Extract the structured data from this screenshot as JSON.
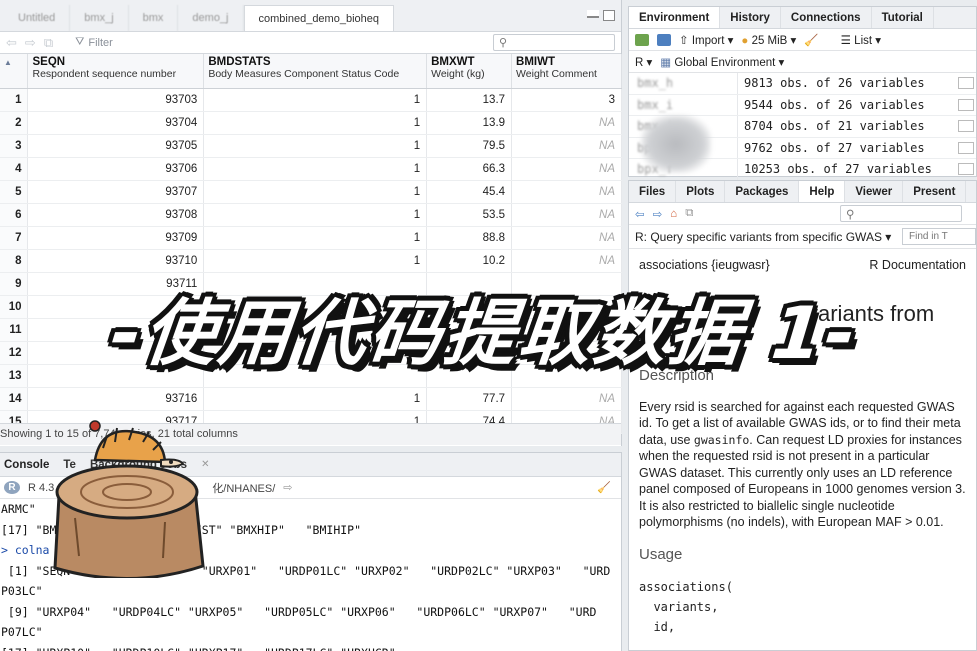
{
  "source_tabs": [
    "Untitled",
    "bmx_j",
    "bmx",
    "demo_j",
    "combined_demo_bioheq"
  ],
  "viewer": {
    "filter_label": "Filter",
    "columns": [
      {
        "name": "SEQN",
        "label": "Respondent sequence number"
      },
      {
        "name": "BMDSTATS",
        "label": "Body Measures Component Status Code"
      },
      {
        "name": "BMXWT",
        "label": "Weight (kg)"
      },
      {
        "name": "BMIWT",
        "label": "Weight Comment"
      }
    ],
    "rows": [
      {
        "n": "1",
        "seqn": "93703",
        "bmdstats": "1",
        "bmxwt": "13.7",
        "bmiwt": "3"
      },
      {
        "n": "2",
        "seqn": "93704",
        "bmdstats": "1",
        "bmxwt": "13.9",
        "bmiwt": "NA"
      },
      {
        "n": "3",
        "seqn": "93705",
        "bmdstats": "1",
        "bmxwt": "79.5",
        "bmiwt": "NA"
      },
      {
        "n": "4",
        "seqn": "93706",
        "bmdstats": "1",
        "bmxwt": "66.3",
        "bmiwt": "NA"
      },
      {
        "n": "5",
        "seqn": "93707",
        "bmdstats": "1",
        "bmxwt": "45.4",
        "bmiwt": "NA"
      },
      {
        "n": "6",
        "seqn": "93708",
        "bmdstats": "1",
        "bmxwt": "53.5",
        "bmiwt": "NA"
      },
      {
        "n": "7",
        "seqn": "93709",
        "bmdstats": "1",
        "bmxwt": "88.8",
        "bmiwt": "NA"
      },
      {
        "n": "8",
        "seqn": "93710",
        "bmdstats": "1",
        "bmxwt": "10.2",
        "bmiwt": "NA"
      },
      {
        "n": "9",
        "seqn": "93711",
        "bmdstats": "",
        "bmxwt": "",
        "bmiwt": ""
      },
      {
        "n": "10",
        "seqn": "",
        "bmdstats": "",
        "bmxwt": "",
        "bmiwt": ""
      },
      {
        "n": "11",
        "seqn": "",
        "bmdstats": "",
        "bmxwt": "",
        "bmiwt": ""
      },
      {
        "n": "12",
        "seqn": "",
        "bmdstats": "",
        "bmxwt": "",
        "bmiwt": ""
      },
      {
        "n": "13",
        "seqn": "",
        "bmdstats": "",
        "bmxwt": "",
        "bmiwt": ""
      },
      {
        "n": "14",
        "seqn": "93716",
        "bmdstats": "1",
        "bmxwt": "77.7",
        "bmiwt": "NA"
      },
      {
        "n": "15",
        "seqn": "93717",
        "bmdstats": "1",
        "bmxwt": "74.4",
        "bmiwt": "NA"
      }
    ],
    "status": "Showing 1 to 15 of 7,74 entries, 21 total columns"
  },
  "console": {
    "tabs": [
      "Console",
      "Te",
      "Background Jobs"
    ],
    "path_prefix": "R 4.3",
    "path_suffix": "化/NHANES/",
    "lines": [
      "ARMC\"",
      "[17] \"BM              \"BMIWAIST\" \"BMXHIP\"   \"BMIHIP\"",
      "> colna",
      " [1] \"SEQN     \"             \"URXP01\"   \"URDP01LC\" \"URXP02\"   \"URDP02LC\" \"URXP03\"   \"URD",
      "P03LC\"",
      " [9] \"URXP04\"   \"URDP04LC\" \"URXP05\"   \"URDP05LC\" \"URXP06\"   \"URDP06LC\" \"URXP07\"   \"URD",
      "P07LC\"",
      "[17] \"URXP10\"   \"URDP10LC\" \"URXP17\"   \"URDP17LC\" \"URXUCR\""
    ]
  },
  "environment": {
    "tabs": [
      "Environment",
      "History",
      "Connections",
      "Tutorial"
    ],
    "import_label": "Import",
    "memory": "25 MiB",
    "list_label": "List",
    "lang": "R",
    "scope": "Global Environment",
    "objects": [
      {
        "name": "bmx_h",
        "value": "9813 obs. of 26 variables"
      },
      {
        "name": "bmx_i",
        "value": "9544 obs. of 26 variables"
      },
      {
        "name": "bmx_j",
        "value": "8704 obs. of 21 variables"
      },
      {
        "name": "bpx_e",
        "value": "9762 obs. of 27 variables"
      },
      {
        "name": "bpx_f",
        "value": "10253 obs. of 27 variables"
      }
    ]
  },
  "help": {
    "tabs": [
      "Files",
      "Plots",
      "Packages",
      "Help",
      "Viewer",
      "Present"
    ],
    "topic": "R: Query specific variants from specific GWAS",
    "find_placeholder": "Find in T",
    "pkg": "associations {ieugwasr}",
    "doc_label": "R Documentation",
    "heading": "variants from",
    "description_title": "Description",
    "description_1": "Every rsid is searched for against each requested GWAS id. To get a list of available GWAS ids, or to find their meta data, use ",
    "description_code": "gwasinfo",
    "description_2": ". Can request LD proxies for instances when the requested rsid is not present in a particular GWAS dataset. This currently only uses an LD reference panel composed of Europeans in 1000 genomes version 3. It is also restricted to biallelic single nucleotide polymorphisms (no indels), with European MAF > 0.01.",
    "usage_title": "Usage",
    "usage_lines": [
      "associations(",
      "  variants,",
      "  id,"
    ]
  },
  "banner": "-使用代码提取数据 1-",
  "colors": {
    "accent": "#1b4aa8",
    "na": "#aaaaaa",
    "banner_text": "#ffffff",
    "banner_outline": "#111111"
  }
}
